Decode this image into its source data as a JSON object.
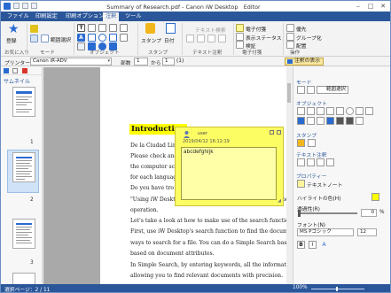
{
  "window": {
    "title": "Summary of Research.pdf - Canon iW Desktop　Editor",
    "minimize": "–",
    "maximize": "□",
    "close": "✕"
  },
  "tabs": [
    "ファイル",
    "印刷設定",
    "印刷オプション",
    "注釈",
    "ツール"
  ],
  "active_tab_index": 3,
  "ribbon": {
    "groups": [
      {
        "label": "お気に入り",
        "items": [
          "登録"
        ]
      },
      {
        "label": "モード",
        "items": [
          "蛍光ペン",
          "範囲選択"
        ]
      },
      {
        "label": "オブジェクト",
        "items": [
          "テキスト",
          "矢印",
          "直線",
          "長方形",
          "楕円",
          "多角形",
          "鉛筆"
        ]
      },
      {
        "label": "スタンプ",
        "items": [
          "スタンプ",
          "日付"
        ]
      },
      {
        "label": "テキスト注釈",
        "items": [
          "テキスト検索"
        ]
      },
      {
        "label": "電子付箋",
        "items": [
          "電子付箋",
          "表示ステータス",
          "検証"
        ]
      },
      {
        "label": "操作",
        "items": [
          "優先",
          "グループ化",
          "配置",
          "整列"
        ]
      }
    ]
  },
  "toolbar": {
    "printer_label": "プリンター：",
    "printer_value": "Canon iR-ADV",
    "copies_label": "部数",
    "copies_value": "1",
    "from_label": "から",
    "page_from": "1",
    "page_to": "(1)",
    "show_annotations": "注釈の表示"
  },
  "left_panel": {
    "title": "サムネイル",
    "pages": [
      "1",
      "2",
      "3"
    ],
    "selected_page": "2"
  },
  "document": {
    "heading": "Introduction",
    "lines": [
      "De la Ciudad Lim",
      "Please check and",
      "the computer scr",
      "for each languag",
      "Do you have tro",
      "\"Using iW Desktop's search function, you can quickly find the",
      "operation.",
      "Let's take a look at how to make use of the search function and",
      "First, use iW Desktop's search function to find the documents tl",
      "ways to search for a file. You can do a Simple Search based on",
      "based on document attributes.",
      "In Simple Search, by entering keywords, all the information con",
      "allowing you to find relevant documents with precision."
    ]
  },
  "sticky_note": {
    "user": "user",
    "date": "2019/04/12 16:12:19",
    "text": "abcdefghijk"
  },
  "right_panel": {
    "mode_label": "モード",
    "mode_button": "範囲選択",
    "object_label": "オブジェクト",
    "stamp_label": "スタンプ",
    "text_annotation_label": "テキスト注釈",
    "properties_label": "プロパティー",
    "property_target": "テキストノート",
    "highlight_color_label": "ハイライトの色(H)",
    "opacity_label": "透過性(R)",
    "opacity_value": "0",
    "opacity_unit": "%",
    "font_label": "フォント(N)",
    "font_value": "MS Pゴシック",
    "font_size": "12",
    "bold": "B",
    "italic": "I",
    "font_color": "A"
  },
  "status_bar": {
    "page_info": "選択ページ：2 / 11",
    "zoom": "100%",
    "zoom_level": 0.5
  },
  "colors": {
    "accent": "#2b579a",
    "highlight": "#ffff00",
    "note": "#fcfc63"
  }
}
